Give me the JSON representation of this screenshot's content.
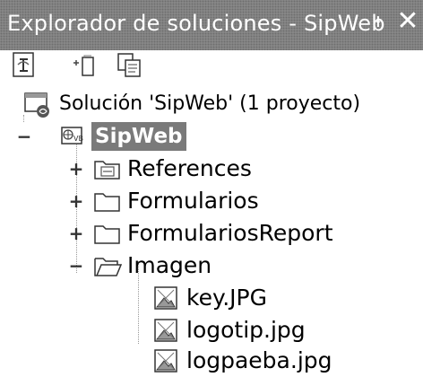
{
  "window": {
    "title": "Explorador de soluciones - SipWeb",
    "pin_glyph": "ᵼ",
    "close_glyph": "✕"
  },
  "toolbar": {
    "buttons": [
      {
        "icon": "properties-icon"
      },
      {
        "icon": "show-all-files-icon"
      },
      {
        "icon": "refresh-icon"
      }
    ]
  },
  "tree": {
    "solution": {
      "label": "Solución 'SipWeb' (1 proyecto)",
      "icon": "solution-icon"
    },
    "project": {
      "label": "SipWeb",
      "icon": "web-project-icon",
      "expander": "−"
    },
    "folders": [
      {
        "label": "References",
        "icon": "references-folder-icon",
        "expander": "+"
      },
      {
        "label": "Formularios",
        "icon": "folder-icon",
        "expander": "+"
      },
      {
        "label": "FormulariosReport",
        "icon": "folder-icon",
        "expander": "+"
      },
      {
        "label": "Imagen",
        "icon": "open-folder-icon",
        "expander": "−"
      }
    ],
    "files": [
      {
        "label": "key.JPG",
        "icon": "image-file-icon"
      },
      {
        "label": "logotip.jpg",
        "icon": "image-file-icon"
      },
      {
        "label": "logpaeba.jpg",
        "icon": "image-file-icon"
      }
    ]
  },
  "colors": {
    "titlebar": "#8c8c8c",
    "selection": "#7a7a7a"
  }
}
